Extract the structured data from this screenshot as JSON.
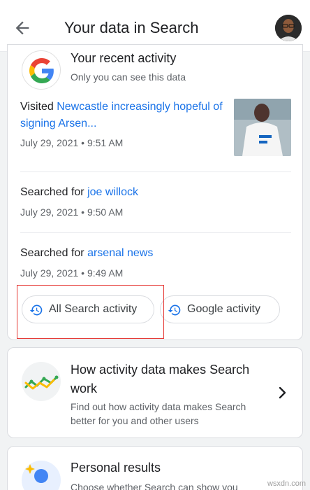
{
  "header": {
    "title": "Your data in Search"
  },
  "recent_activity": {
    "title": "Your recent activity",
    "subtitle": "Only you can see this data",
    "entries": [
      {
        "prefix": "Visited ",
        "link": "Newcastle increasingly hopeful of signing Arsen...",
        "time": "July 29, 2021 • 9:51 AM"
      },
      {
        "prefix": "Searched for ",
        "link": "joe willock",
        "time": "July 29, 2021 • 9:50 AM"
      },
      {
        "prefix": "Searched for ",
        "link": "arsenal news",
        "time": "July 29, 2021 • 9:49 AM"
      }
    ],
    "chips": {
      "all_search": "All Search activity",
      "google": "Google activity"
    }
  },
  "how_activity": {
    "title": "How activity data makes Search work",
    "subtitle": "Find out how activity data makes Search better for you and other users"
  },
  "personal_results": {
    "title": "Personal results",
    "subtitle": "Choose whether Search can show you"
  },
  "watermark": "wsxdn.com",
  "colors": {
    "link": "#1a73e8",
    "highlight": "#e53935"
  },
  "icons": [
    "back-arrow-icon",
    "google-logo-icon",
    "history-icon",
    "chevron-right-icon"
  ]
}
